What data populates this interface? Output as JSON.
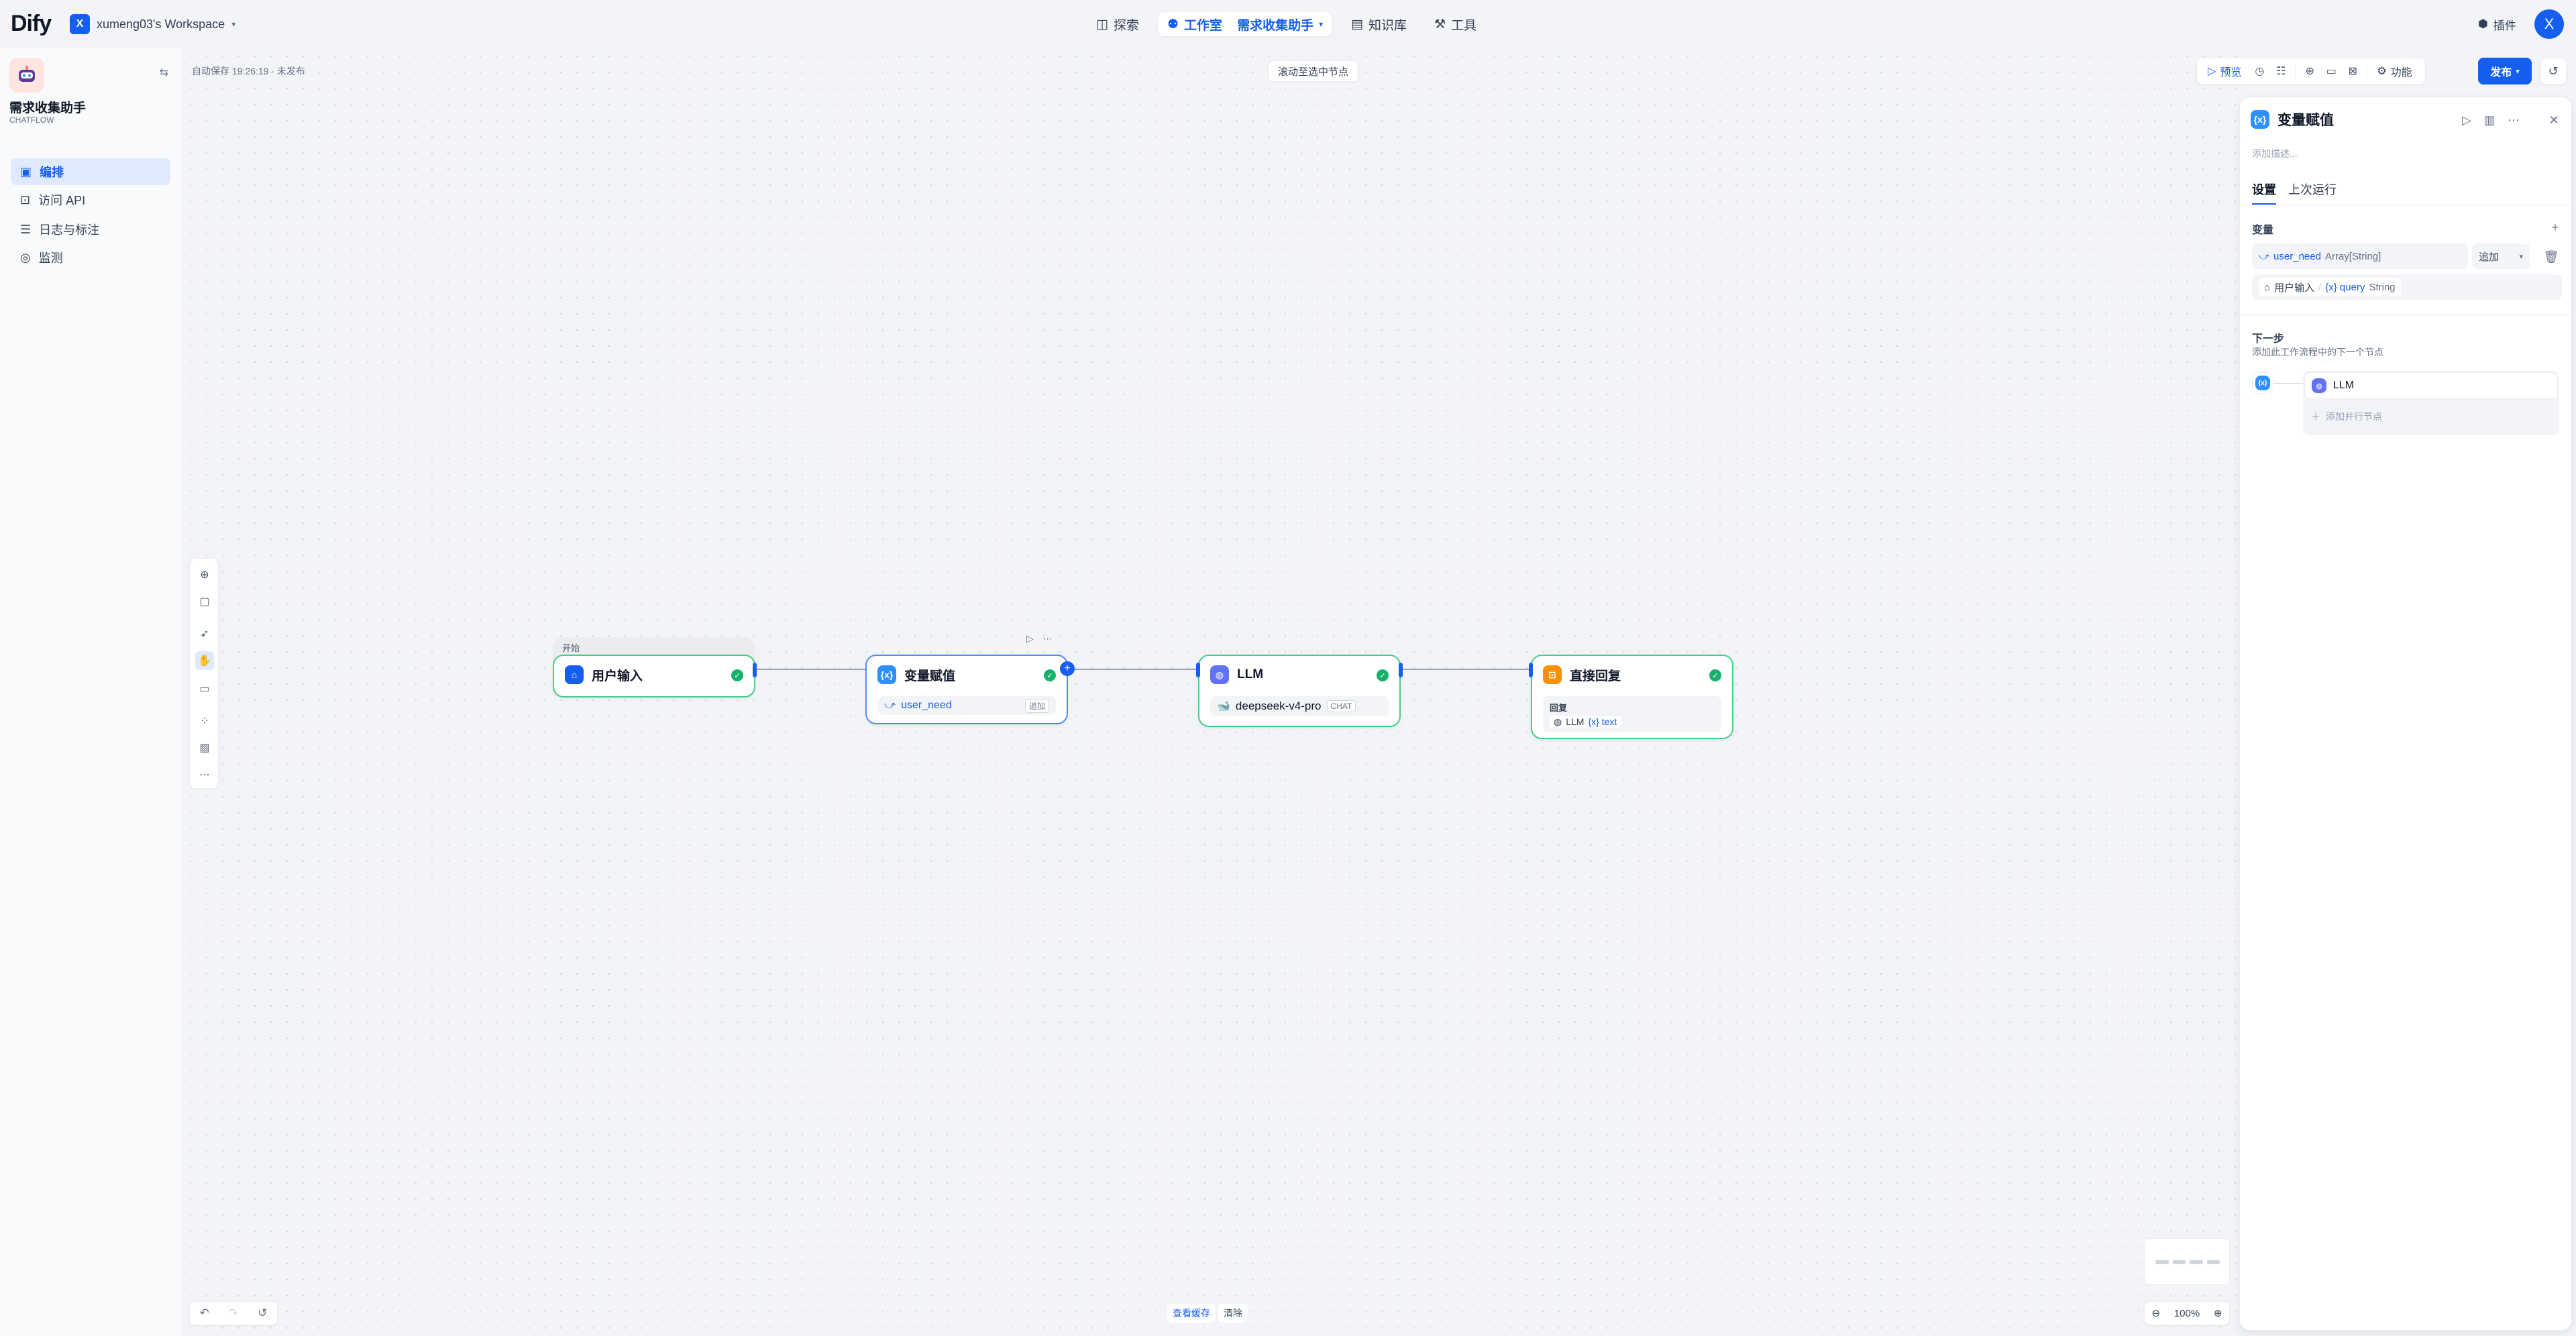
{
  "topbar": {
    "logo": "Dify",
    "workspace_badge": "X",
    "workspace_name": "xumeng03's Workspace",
    "nav": {
      "explore": "探索",
      "studio": "工作室",
      "current_app": "需求收集助手",
      "knowledge": "知识库",
      "tools": "工具"
    },
    "plugins": "插件",
    "avatar": "X"
  },
  "sidebar": {
    "app_name": "需求收集助手",
    "app_mode": "CHATFLOW",
    "items": [
      {
        "label": "编排",
        "icon": "layout-icon",
        "active": true
      },
      {
        "label": "访问 API",
        "icon": "terminal-icon",
        "active": false
      },
      {
        "label": "日志与标注",
        "icon": "file-list-icon",
        "active": false
      },
      {
        "label": "监测",
        "icon": "monitor-icon",
        "active": false
      }
    ]
  },
  "canvas": {
    "autosave": "自动保存 19:26:19 · 未发布",
    "scroll_hint": "滚动至选中节点",
    "header_actions": {
      "preview": "预览",
      "features": "功能",
      "publish": "发布"
    },
    "nodes": {
      "start": {
        "group_label": "开始",
        "title": "用户输入"
      },
      "assigner": {
        "title": "变量赋值",
        "var": "user_need",
        "op": "追加"
      },
      "llm": {
        "title": "LLM",
        "model": "deepseek-v4-pro",
        "mode": "CHAT"
      },
      "answer": {
        "title": "直接回复",
        "label": "回复",
        "source": "LLM",
        "var": "{x} text"
      }
    },
    "bottom": {
      "view_cache": "查看缓存",
      "clear": "清除",
      "zoom": "100%"
    }
  },
  "panel": {
    "title": "变量赋值",
    "desc_placeholder": "添加描述...",
    "tabs": [
      "设置",
      "上次运行"
    ],
    "variables_label": "变量",
    "target_var": "user_need",
    "target_type": "Array[String]",
    "operation": "追加",
    "source_node": "用户输入",
    "source_var": "{x} query",
    "source_type": "String",
    "next_step_title": "下一步",
    "next_step_desc": "添加此工作流程中的下一个节点",
    "next_node": "LLM",
    "add_parallel": "添加并行节点"
  },
  "colors": {
    "accent": "#155eef",
    "success": "#17b26a",
    "node_border": "#47cd89",
    "answer_icon": "#f79009",
    "llm_icon": "#6172f3"
  }
}
